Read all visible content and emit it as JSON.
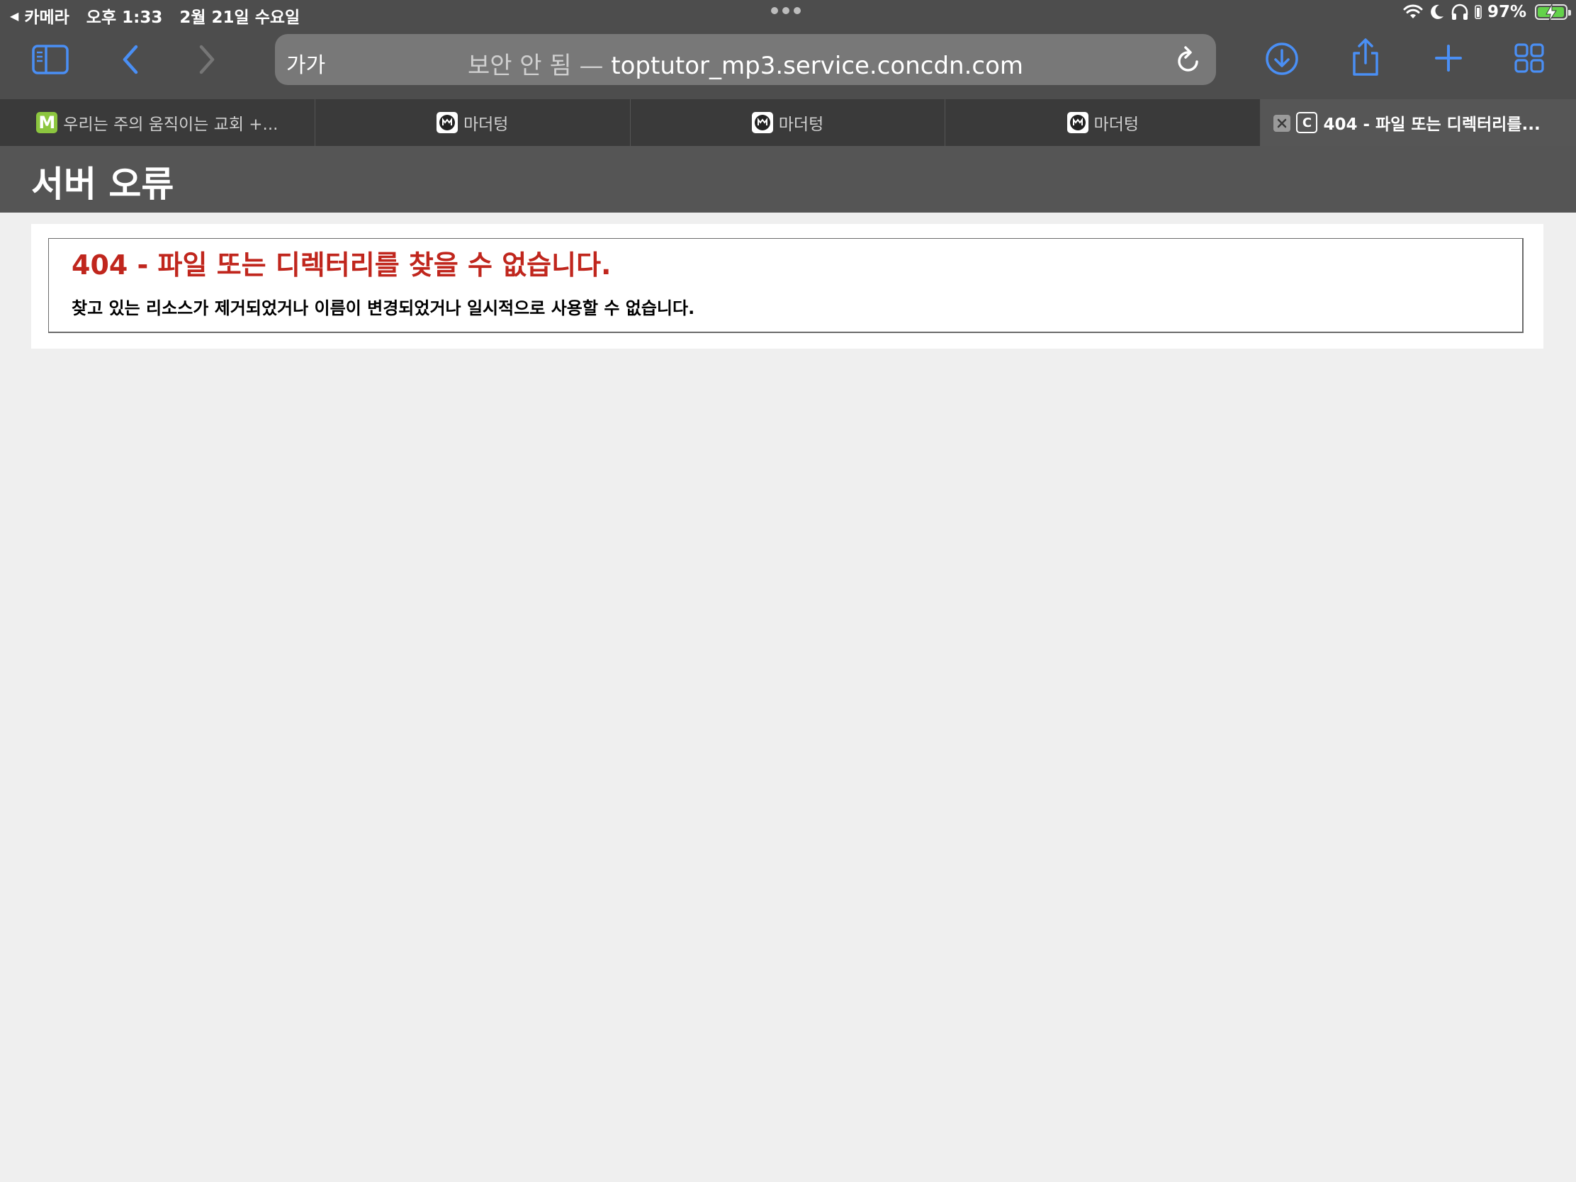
{
  "status_bar": {
    "back_app": "카메라",
    "time": "오후 1:33",
    "date": "2월 21일 수요일",
    "battery": "97%",
    "battery_level": 0.97
  },
  "toolbar": {
    "reader_label": "가가",
    "url_security": "보안 안 됨 —",
    "url_host": "toptutor_mp3.service.concdn.com"
  },
  "tabs": [
    {
      "label": "우리는 주의 움직이는 교회 +...",
      "favicon": "M"
    },
    {
      "label": "마더텅"
    },
    {
      "label": "마더텅"
    },
    {
      "label": "마더텅"
    },
    {
      "label": "404 - 파일 또는 디렉터리를...",
      "favicon": "C"
    }
  ],
  "page": {
    "header_title": "서버 오류",
    "error_title": "404 - 파일 또는 디렉터리를 찾을 수 없습니다.",
    "error_desc": "찾고 있는 리소스가 제거되었거나 이름이 변경되었거나 일시적으로 사용할 수 없습니다."
  },
  "colors": {
    "accent_blue": "#3b82f6",
    "error_red": "#c0261d",
    "header_gray": "#555555"
  },
  "icons": [
    "sidebar-icon",
    "back-icon",
    "forward-icon",
    "reload-icon",
    "download-icon",
    "share-icon",
    "new-tab-icon",
    "tab-overview-icon",
    "wifi-icon",
    "moon-icon",
    "headphones-icon",
    "battery-icon"
  ]
}
